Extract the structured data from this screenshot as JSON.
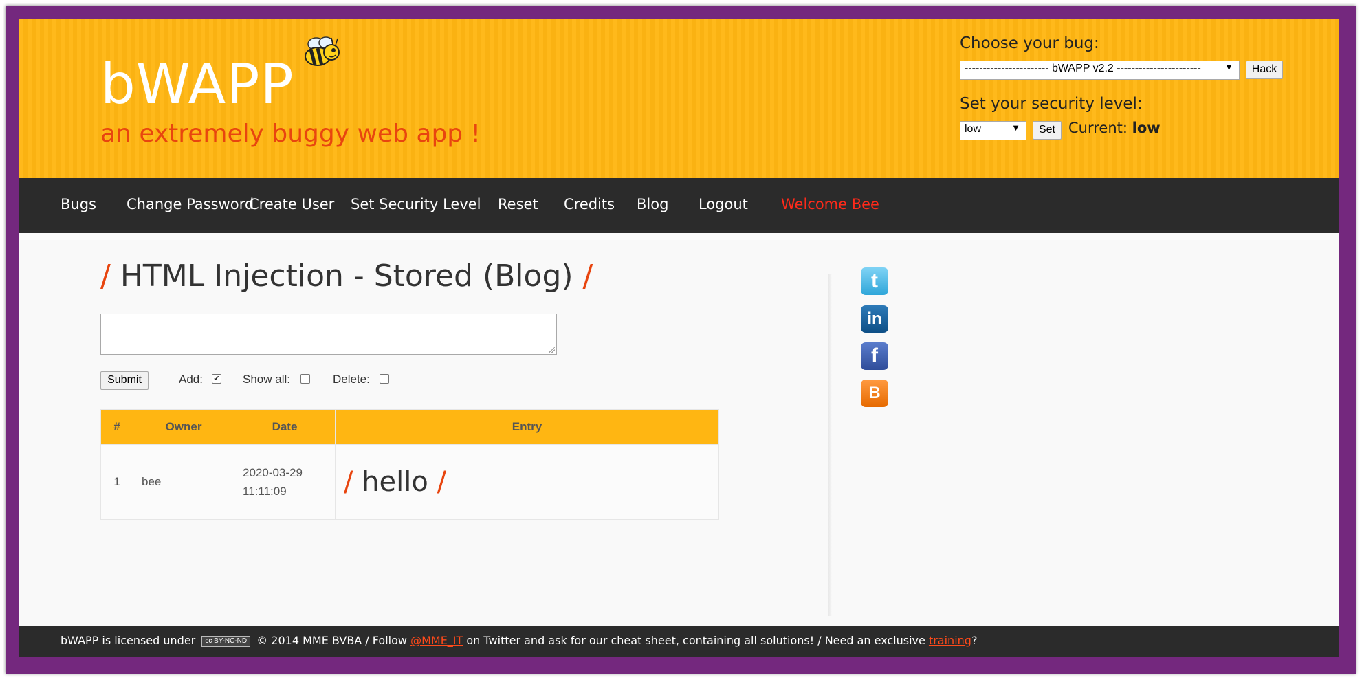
{
  "header": {
    "logo": "bWAPP",
    "tagline": "an extremely buggy web app !",
    "choose_bug_label": "Choose your bug:",
    "bug_select_value": "----------------------- bWAPP v2.2 -----------------------",
    "hack_button": "Hack",
    "security_label": "Set your security level:",
    "security_select_value": "low",
    "set_button": "Set",
    "current_label": "Current:",
    "current_value": "low"
  },
  "nav": {
    "items": [
      "Bugs",
      "Change Password",
      "Create User",
      "Set Security Level",
      "Reset",
      "Credits",
      "Blog",
      "Logout"
    ],
    "welcome": "Welcome Bee"
  },
  "main": {
    "title_slash": "/",
    "title": "HTML Injection - Stored (Blog)",
    "textarea_value": "",
    "submit_button": "Submit",
    "add_label": "Add:",
    "add_checked": true,
    "show_all_label": "Show all:",
    "show_all_checked": false,
    "delete_label": "Delete:",
    "delete_checked": false,
    "table": {
      "columns": [
        "#",
        "Owner",
        "Date",
        "Entry"
      ],
      "rows": [
        {
          "num": "1",
          "owner": "bee",
          "date": "2020-03-29",
          "time": "11:11:09",
          "entry": "hello"
        }
      ]
    }
  },
  "sidebar": {
    "icons": [
      "twitter-icon",
      "linkedin-icon",
      "facebook-icon",
      "blogger-icon"
    ],
    "twitter_glyph": "t",
    "linkedin_glyph": "in",
    "facebook_glyph": "f",
    "blogger_glyph": "B"
  },
  "footer": {
    "text_1": "bWAPP is licensed under",
    "badge": "cc BY-NC-ND",
    "text_2": "© 2014 MME BVBA / Follow",
    "twitter_link": "@MME_IT",
    "text_3": "on Twitter and ask for our cheat sheet, containing all solutions! / Need an exclusive",
    "training_link": "training",
    "text_4": "?"
  },
  "colors": {
    "brand_purple": "#74287e",
    "header_yellow": "#ffb612",
    "accent_orange": "#e8450f",
    "nav_dark": "#2b2b2b",
    "welcome_red": "#ff2a1a"
  }
}
